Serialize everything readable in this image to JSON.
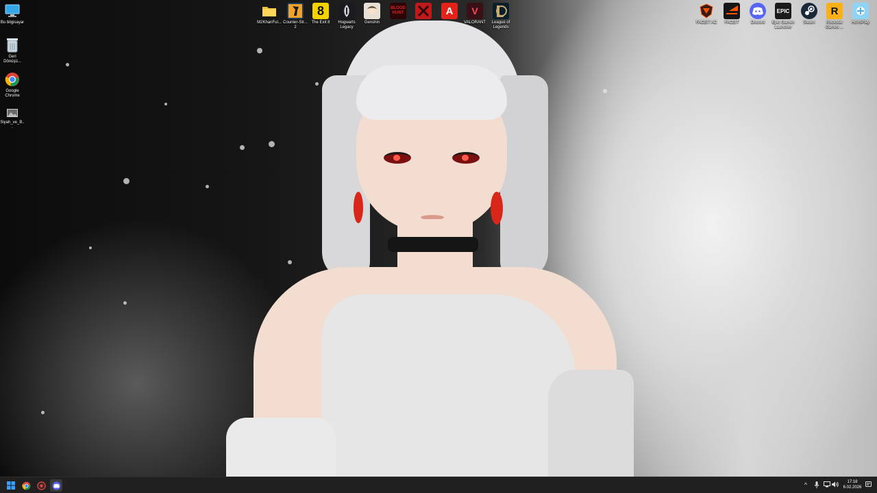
{
  "desktop": {
    "left_icons": [
      {
        "label": "Bu bilgisayar",
        "icon": "monitor-icon"
      },
      {
        "label": "Geri Dönüşü...",
        "icon": "recycle-bin-icon"
      },
      {
        "label": "Google Chrome",
        "icon": "chrome-icon"
      },
      {
        "label": "Siyah_ve_B...",
        "icon": "image-file-icon"
      }
    ],
    "top_icons": [
      {
        "label": "M2KhanFul...",
        "icon": "folder-icon"
      },
      {
        "label": "Counter-Str... 2",
        "icon": "counter-strike-icon"
      },
      {
        "label": "The Exit 8",
        "icon": "exit8-icon",
        "glyph": "8"
      },
      {
        "label": "Hogwarts Legacy",
        "icon": "hogwarts-icon"
      },
      {
        "label": "Genshin",
        "icon": "genshin-icon"
      },
      {
        "label": "",
        "icon": "bloodhunt-icon",
        "glyph": "BLOOD HUNT"
      },
      {
        "label": "",
        "icon": "game-red-icon"
      },
      {
        "label": "",
        "icon": "adobe-acrobat-icon",
        "glyph": "A"
      },
      {
        "label": "VALORANT",
        "icon": "valorant-icon",
        "glyph": "V"
      },
      {
        "label": "League of Legends",
        "icon": "league-icon"
      }
    ],
    "right_icons": [
      {
        "label": "FACEIT AC",
        "icon": "faceit-ac-icon"
      },
      {
        "label": "FACEIT",
        "icon": "faceit-icon"
      },
      {
        "label": "Discord",
        "icon": "discord-icon"
      },
      {
        "label": "Epic Games Launcher",
        "icon": "epic-games-icon",
        "glyph": "EPIC"
      },
      {
        "label": "Steam",
        "icon": "steam-icon"
      },
      {
        "label": "Rockstar Games ...",
        "icon": "rockstar-icon",
        "glyph": "R"
      },
      {
        "label": "HoYoPlay",
        "icon": "hoyoplay-icon"
      }
    ]
  },
  "taskbar": {
    "pinned": [
      {
        "name": "start-button",
        "icon": "windows-icon"
      },
      {
        "name": "chrome-taskbar-button",
        "icon": "chrome-icon"
      },
      {
        "name": "app-taskbar-button",
        "icon": "app-icon"
      },
      {
        "name": "discord-taskbar-button",
        "icon": "discord-icon"
      }
    ],
    "clock": {
      "time": "17:18",
      "date": "6.02.2026"
    }
  },
  "colors": {
    "taskbar_bg": "#202020",
    "windows_blue": "#3aa0ff",
    "discord": "#5865F2",
    "steam": "#1b2838",
    "valorant": "#ff4655",
    "rockstar": "#fcaf17",
    "adobe": "#e2231a"
  }
}
